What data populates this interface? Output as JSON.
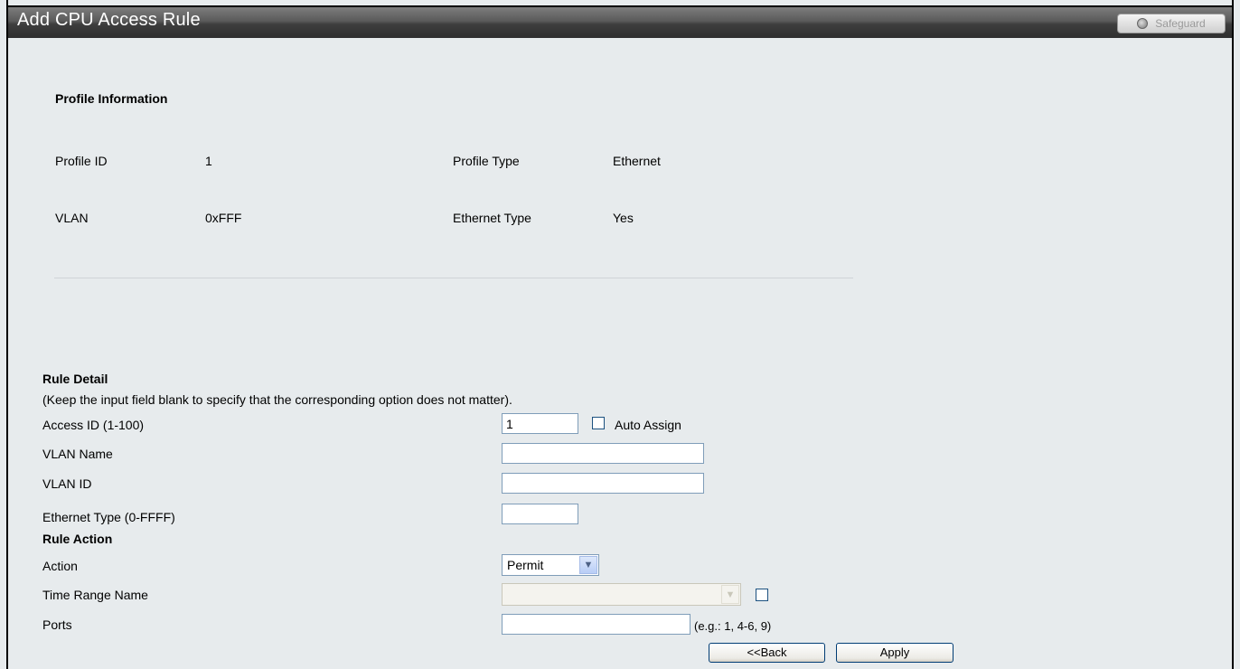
{
  "window": {
    "title": "Add CPU Access Rule",
    "safeguard_label": "Safeguard"
  },
  "profile": {
    "heading": "Profile Information",
    "id_label": "Profile ID",
    "id_value": "1",
    "type_label": "Profile Type",
    "type_value": "Ethernet",
    "vlan_label": "VLAN",
    "vlan_value": "0xFFF",
    "ethertype_label": "Ethernet Type",
    "ethertype_value": "Yes"
  },
  "rule": {
    "heading": "Rule Detail",
    "note": "(Keep the input field blank to specify that the corresponding option does not matter).",
    "access_id_label": "Access ID (1-100)",
    "access_id_value": "1",
    "auto_assign_label": "Auto Assign",
    "vlan_name_label": "VLAN Name",
    "vlan_name_value": "",
    "vlan_id_label": "VLAN ID",
    "vlan_id_value": "",
    "ethertype_label": "Ethernet Type  (0-FFFF)",
    "ethertype_value": ""
  },
  "action": {
    "heading": "Rule Action",
    "action_label": "Action",
    "action_value": "Permit",
    "time_range_label": "Time Range Name",
    "time_range_value": "",
    "ports_label": "Ports",
    "ports_value": "",
    "ports_hint": "(e.g.: 1, 4-6, 9)"
  },
  "buttons": {
    "back": "<<Back",
    "apply": "Apply"
  }
}
